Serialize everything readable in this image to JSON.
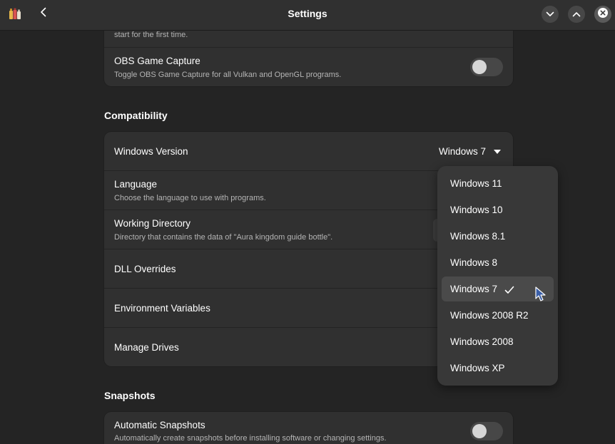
{
  "header": {
    "title": "Settings",
    "app_icon": "bottles-app-icon",
    "back_icon": "back-chevron-icon",
    "minimize_icon": "chevron-down-icon",
    "maximize_icon": "chevron-up-icon",
    "close_icon": "close-icon"
  },
  "top_group": {
    "partial_row": {
      "subtitle": "start for the first time."
    },
    "obs_row": {
      "title": "OBS Game Capture",
      "subtitle": "Toggle OBS Game Capture for all Vulkan and OpenGL programs.",
      "enabled": false
    }
  },
  "compatibility": {
    "section_title": "Compatibility",
    "windows_version": {
      "title": "Windows Version",
      "value": "Windows 7"
    },
    "language": {
      "title": "Language",
      "subtitle": "Choose the language to use with programs."
    },
    "working_directory": {
      "title": "Working Directory",
      "subtitle": "Directory that contains the data of \"Aura kingdom guide bottle\"."
    },
    "dll_overrides": {
      "title": "DLL Overrides"
    },
    "env_vars": {
      "title": "Environment Variables"
    },
    "manage_drives": {
      "title": "Manage Drives"
    }
  },
  "snapshots": {
    "section_title": "Snapshots",
    "automatic": {
      "title": "Automatic Snapshots",
      "subtitle": "Automatically create snapshots before installing software or changing settings.",
      "enabled": false
    }
  },
  "version_popover": {
    "options": [
      "Windows 11",
      "Windows 10",
      "Windows 8.1",
      "Windows 8",
      "Windows 7",
      "Windows 2008 R2",
      "Windows 2008",
      "Windows XP"
    ],
    "selected": "Windows 7",
    "check_icon": "checkmark-icon"
  },
  "colors": {
    "window_bg": "#242424",
    "card_bg": "#303030",
    "popover_bg": "#383838",
    "selected_bg": "#4a4a4a",
    "cursor": "#3a5fa8"
  }
}
